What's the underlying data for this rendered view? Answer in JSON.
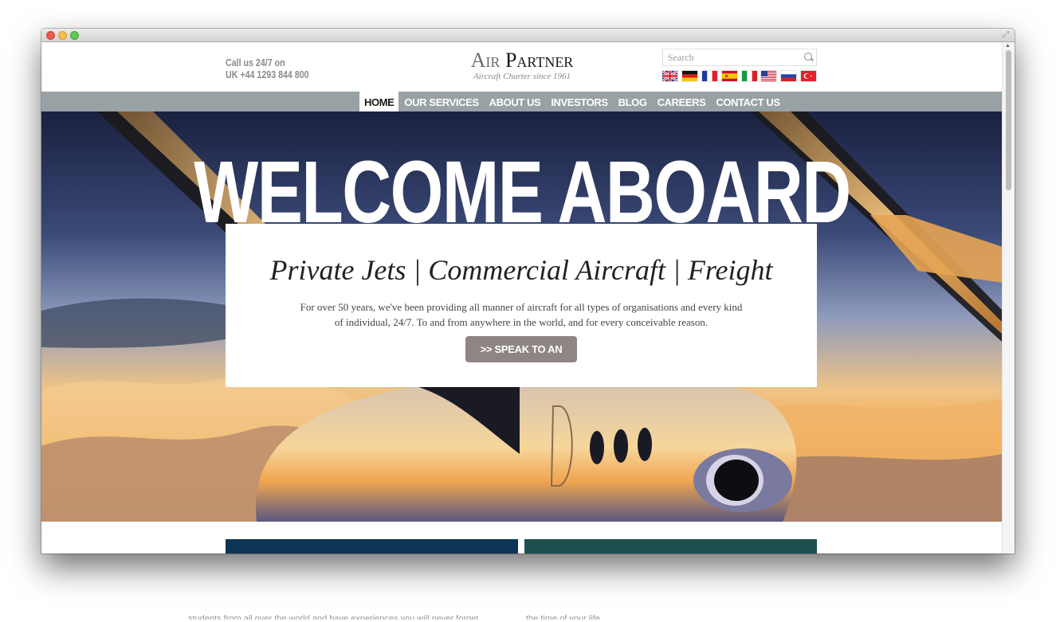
{
  "window": {
    "controls": [
      "close",
      "minimize",
      "zoom"
    ],
    "expand_icon": "fullscreen-icon"
  },
  "header": {
    "call_line1": "Call us 24/7 on",
    "call_line2": "UK +44 1293 844 800",
    "logo_air": "Air",
    "logo_partner": "Partner",
    "logo_tagline": "Aircraft Charter since 1961",
    "search_placeholder": "Search",
    "flags": [
      {
        "name": "uk-flag",
        "country": "United Kingdom"
      },
      {
        "name": "germany-flag",
        "country": "Germany"
      },
      {
        "name": "france-flag",
        "country": "France"
      },
      {
        "name": "spain-flag",
        "country": "Spain"
      },
      {
        "name": "italy-flag",
        "country": "Italy"
      },
      {
        "name": "usa-flag",
        "country": "United States"
      },
      {
        "name": "russia-flag",
        "country": "Russia"
      },
      {
        "name": "turkey-flag",
        "country": "Turkey"
      }
    ]
  },
  "nav": {
    "items": [
      {
        "label": "HOME",
        "active": true
      },
      {
        "label": "OUR SERVICES",
        "active": false
      },
      {
        "label": "ABOUT US",
        "active": false
      },
      {
        "label": "INVESTORS",
        "active": false
      },
      {
        "label": "BLOG",
        "active": false
      },
      {
        "label": "CAREERS",
        "active": false
      },
      {
        "label": "CONTACT US",
        "active": false
      }
    ]
  },
  "hero": {
    "title": "WELCOME ABOARD",
    "subtitle": "Private Jets | Commercial Aircraft | Freight",
    "description": "For over 50 years, we've been providing all manner of aircraft for all types of organisations and every kind of individual, 24/7. To and from anywhere in the world, and for every conceivable  reason.",
    "cta": ">> SPEAK TO AN EXPERT"
  },
  "panels": {
    "left_color": "#0e3556",
    "right_color": "#1e5050"
  },
  "below_fold": {
    "left_text": "students from all over the world and have experiences you will never forget",
    "right_text": "the time of your life"
  },
  "colors": {
    "nav_bg": "#98a1a4",
    "cta_bg": "#8f8683"
  }
}
